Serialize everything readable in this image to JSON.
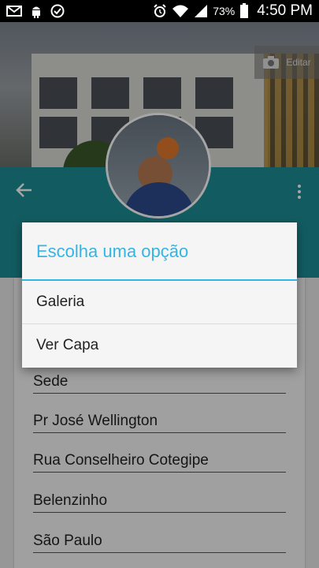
{
  "status_bar": {
    "battery": "73%",
    "time": "4:50 PM",
    "left_icons": [
      "gmail-icon",
      "android-icon",
      "check-circle-icon"
    ],
    "right_icons": [
      "alarm-icon",
      "wifi-icon",
      "signal-icon",
      "battery-icon"
    ]
  },
  "cover": {
    "edit_label": "Editar",
    "edit_icon": "camera-icon"
  },
  "toolbar": {
    "back_icon": "arrow-back-icon",
    "more_icon": "more-vert-icon",
    "color": "#1c8e96"
  },
  "dialog": {
    "title": "Escolha uma opção",
    "options": [
      "Galeria",
      "Ver Capa"
    ],
    "accent": "#33b5e5"
  },
  "list": {
    "items": [
      "Sede",
      "Pr José Wellington",
      "Rua Conselheiro Cotegipe",
      "Belenzinho",
      "São Paulo"
    ]
  }
}
